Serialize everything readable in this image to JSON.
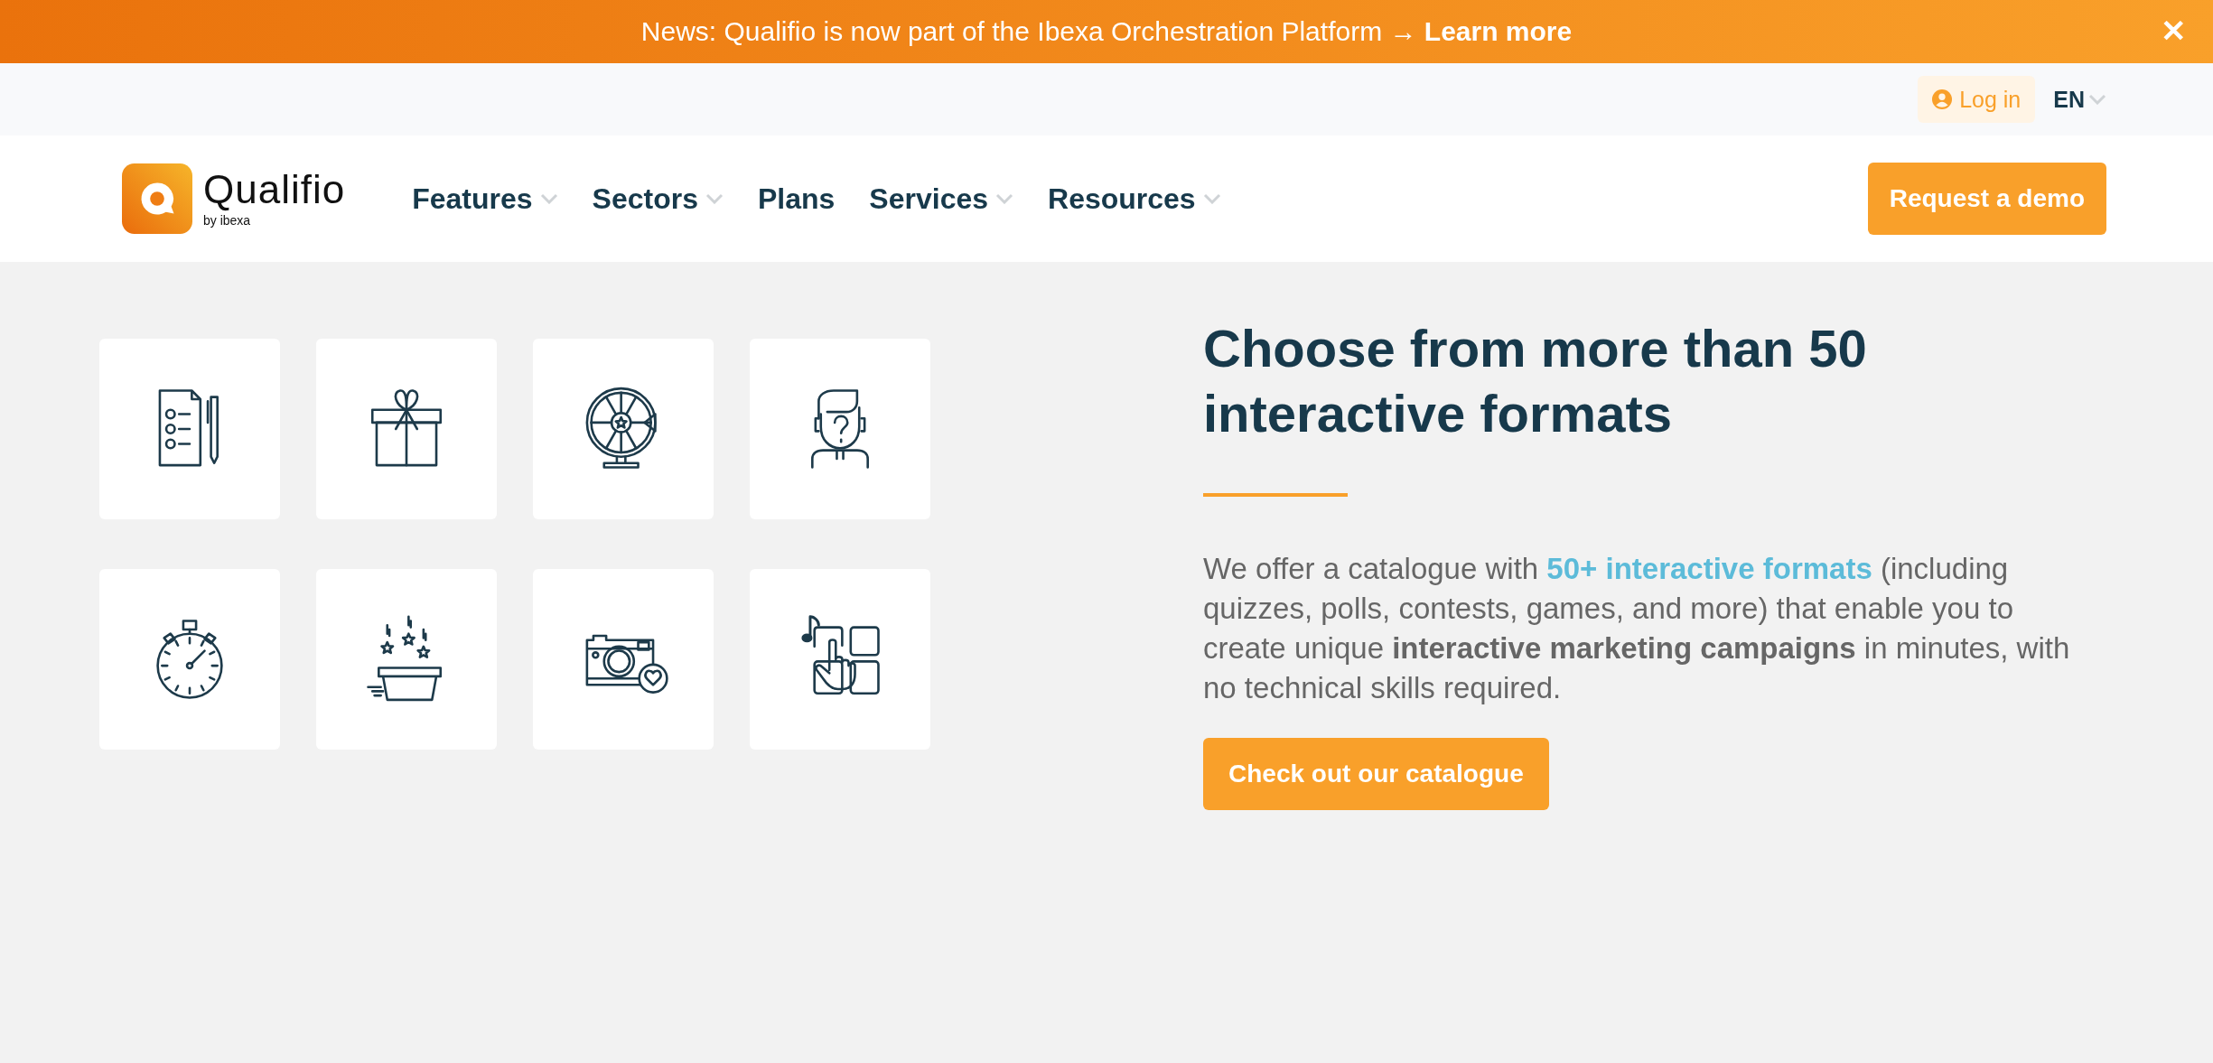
{
  "banner": {
    "text": "News: Qualifio is now part of the Ibexa Orchestration Platform → ",
    "link": "Learn more",
    "close": "✕"
  },
  "topbar": {
    "login": "Log in",
    "language": "EN"
  },
  "header": {
    "logo_name": "Qualifio",
    "logo_sub": "by ibexa",
    "nav": [
      {
        "label": "Features",
        "dropdown": true
      },
      {
        "label": "Sectors",
        "dropdown": true
      },
      {
        "label": "Plans",
        "dropdown": false
      },
      {
        "label": "Services",
        "dropdown": true
      },
      {
        "label": "Resources",
        "dropdown": true
      }
    ],
    "cta": "Request a demo"
  },
  "hero": {
    "title": "Choose from more than 50 interactive formats",
    "paragraph": {
      "before": "We offer a catalogue with ",
      "link": "50+ interactive formats",
      "after": " (including quizzes, polls, contests, games, and more) that enable you to create unique **interactive marketing campaigns** in minutes, with no technical skills required."
    },
    "button": "Check out our catalogue"
  }
}
